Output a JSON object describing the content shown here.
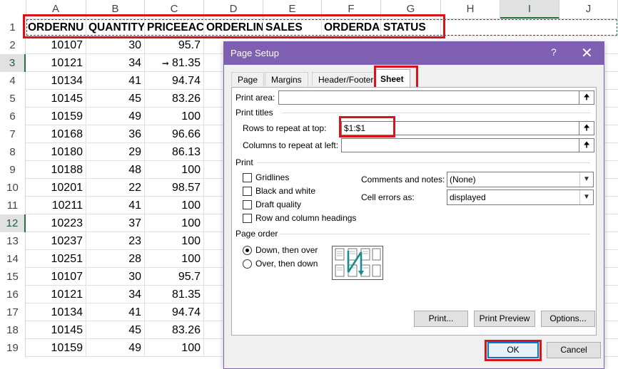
{
  "spreadsheet": {
    "columns": [
      "A",
      "B",
      "C",
      "D",
      "E",
      "F",
      "G",
      "H",
      "I",
      "J"
    ],
    "header_cells": [
      "ORDERNU",
      "QUANTITY",
      "PRICEEACI",
      "ORDERLIN",
      "SALES",
      "ORDERDA",
      "STATUS"
    ],
    "rows": [
      {
        "num": "1"
      },
      {
        "num": "2",
        "a": "10107",
        "b": "30",
        "c": "95.7"
      },
      {
        "num": "3",
        "a": "10121",
        "b": "34",
        "c": "81.35",
        "arrow": "➞"
      },
      {
        "num": "4",
        "a": "10134",
        "b": "41",
        "c": "94.74"
      },
      {
        "num": "5",
        "a": "10145",
        "b": "45",
        "c": "83.26"
      },
      {
        "num": "6",
        "a": "10159",
        "b": "49",
        "c": "100"
      },
      {
        "num": "7",
        "a": "10168",
        "b": "36",
        "c": "96.66"
      },
      {
        "num": "8",
        "a": "10180",
        "b": "29",
        "c": "86.13"
      },
      {
        "num": "9",
        "a": "10188",
        "b": "48",
        "c": "100"
      },
      {
        "num": "10",
        "a": "10201",
        "b": "22",
        "c": "98.57"
      },
      {
        "num": "11",
        "a": "10211",
        "b": "41",
        "c": "100"
      },
      {
        "num": "12",
        "a": "10223",
        "b": "37",
        "c": "100"
      },
      {
        "num": "13",
        "a": "10237",
        "b": "23",
        "c": "100"
      },
      {
        "num": "14",
        "a": "10251",
        "b": "28",
        "c": "100"
      },
      {
        "num": "15",
        "a": "10107",
        "b": "30",
        "c": "95.7"
      },
      {
        "num": "16",
        "a": "10121",
        "b": "34",
        "c": "81.35"
      },
      {
        "num": "17",
        "a": "10134",
        "b": "41",
        "c": "94.74"
      },
      {
        "num": "18",
        "a": "10145",
        "b": "45",
        "c": "83.26"
      },
      {
        "num": "19",
        "a": "10159",
        "b": "49",
        "c": "100"
      }
    ]
  },
  "dialog": {
    "title": "Page Setup",
    "help": "?",
    "close": "✕",
    "tabs": [
      "Page",
      "Margins",
      "Header/Footer",
      "Sheet"
    ],
    "print_area_label": "Print area:",
    "print_area_value": "",
    "print_titles_label": "Print titles",
    "rows_repeat_label": "Rows to repeat at top:",
    "rows_repeat_value": "$1:$1",
    "cols_repeat_label": "Columns to repeat at left:",
    "cols_repeat_value": "",
    "print_section": "Print",
    "checkboxes": [
      "Gridlines",
      "Black and white",
      "Draft quality",
      "Row and column headings"
    ],
    "comments_label": "Comments and notes:",
    "comments_value": "(None)",
    "cell_errors_label": "Cell errors as:",
    "cell_errors_value": "displayed",
    "page_order_label": "Page order",
    "radio_down": "Down, then over",
    "radio_over": "Over, then down",
    "btn_print": "Print...",
    "btn_preview": "Print Preview",
    "btn_options": "Options...",
    "btn_ok": "OK",
    "btn_cancel": "Cancel",
    "collapse_icon": "🠉"
  },
  "colors": {
    "accent": "#217346",
    "dialog_title": "#7e5fb1",
    "highlight": "#d9131a"
  }
}
